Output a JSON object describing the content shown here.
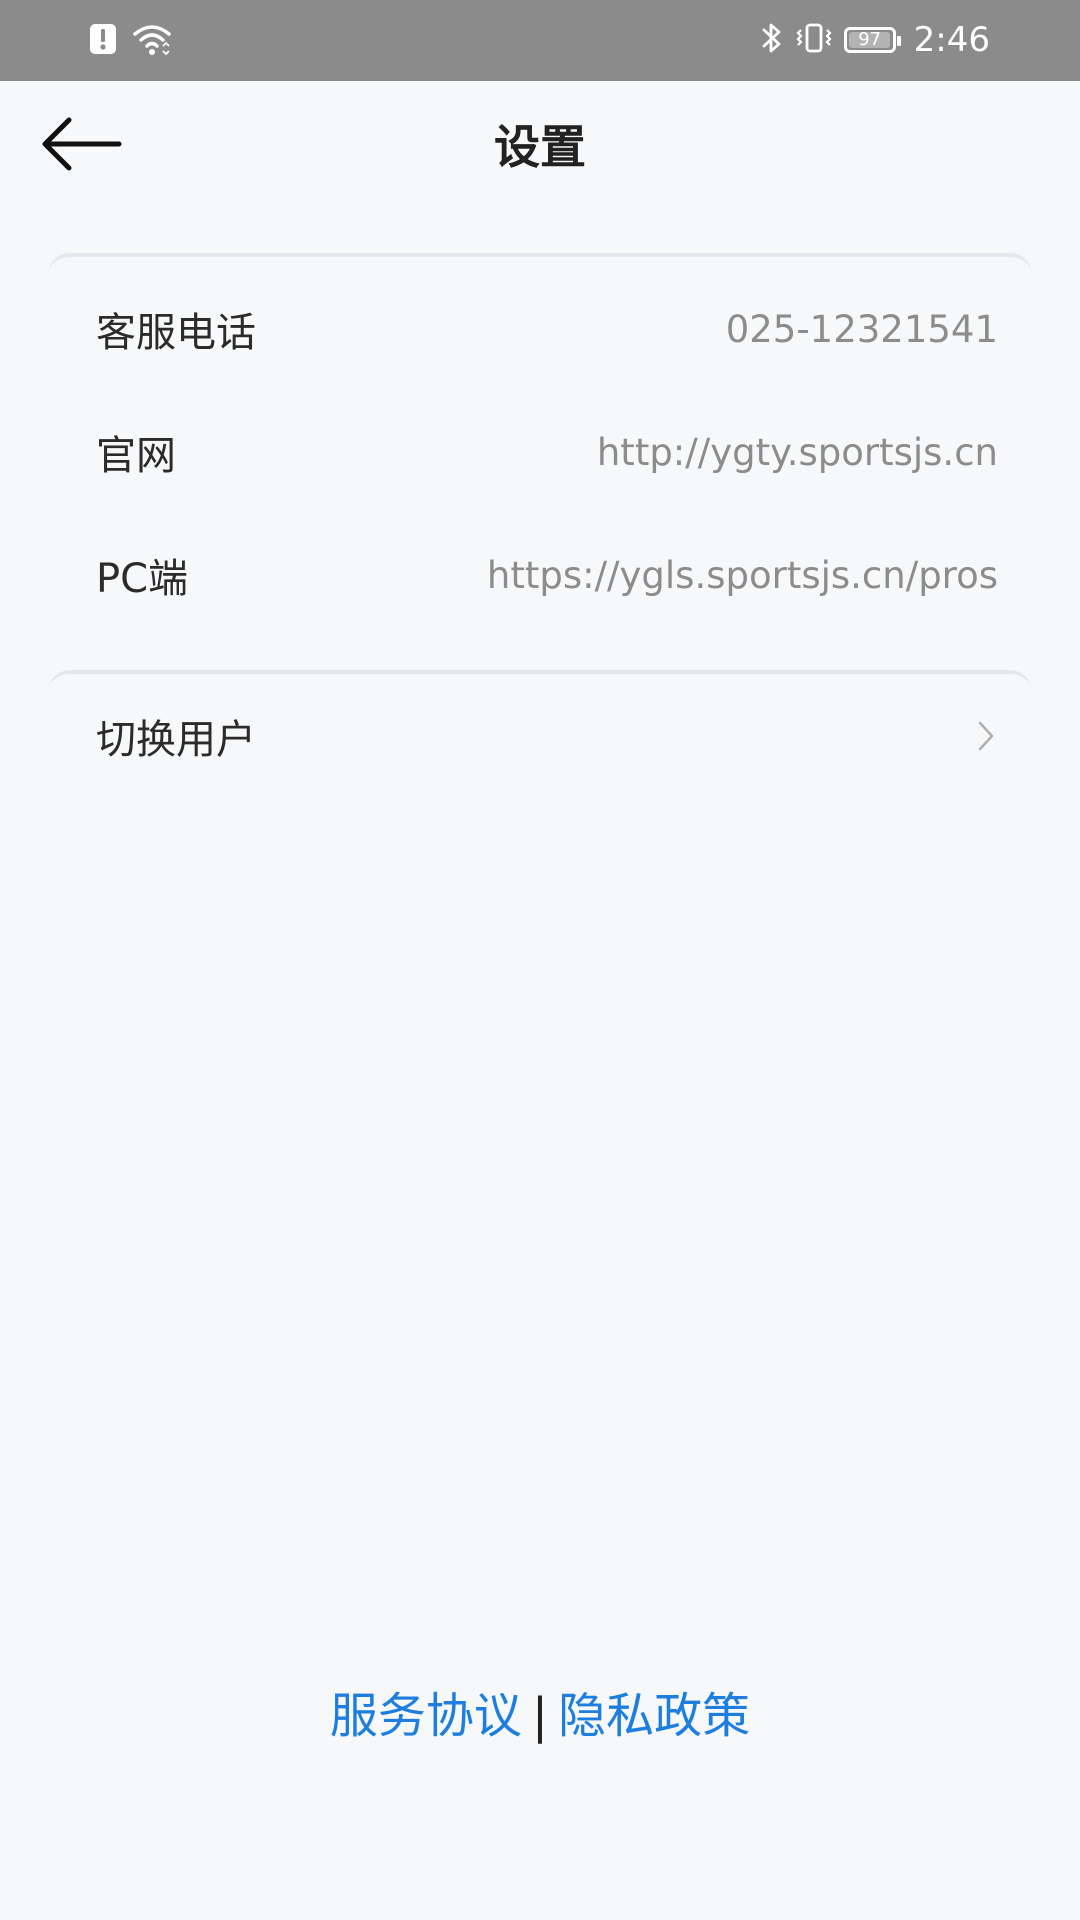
{
  "status_bar": {
    "time": "2:46",
    "battery_level": "97",
    "battery_fraction": 0.97,
    "icons_left": [
      "alert-icon",
      "wifi-icon"
    ],
    "icons_right": [
      "bluetooth-icon",
      "vibrate-icon",
      "battery-icon"
    ]
  },
  "header": {
    "title": "设置",
    "back_icon": "arrow-left-icon"
  },
  "info_card": {
    "rows": [
      {
        "label": "客服电话",
        "value": "025-12321541"
      },
      {
        "label": "官网",
        "value": "http://ygty.sportsjs.cn"
      },
      {
        "label": "PC端",
        "value": "https://ygls.sportsjs.cn/pros"
      }
    ]
  },
  "switch_card": {
    "label": "切换用户",
    "icon": "chevron-right-icon"
  },
  "footer": {
    "service_agreement": "服务协议",
    "separator": "|",
    "privacy_policy": "隐私政策"
  },
  "colors": {
    "status_bar_bg": "#8b8b8b",
    "page_bg": "#f7f8fa",
    "link": "#1e7ee0",
    "value_text": "#8c8c8c",
    "label_text": "#2b2b2b"
  }
}
